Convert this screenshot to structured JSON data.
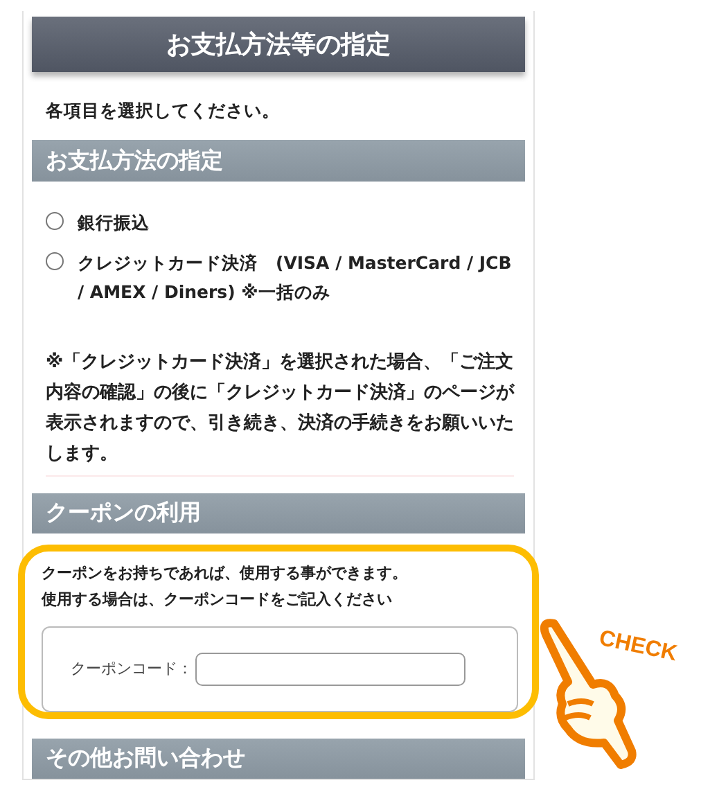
{
  "header": {
    "title": "お支払方法等の指定"
  },
  "intro": "各項目を選択してください。",
  "payment": {
    "title": "お支払方法の指定",
    "options": [
      {
        "label": "銀行振込",
        "selected": false
      },
      {
        "label": "クレジットカード決済　(VISA / MasterCard / JCB / AMEX / Diners) ※一括のみ",
        "selected": false
      }
    ],
    "note": "※「クレジットカード決済」を選択された場合、「ご注文内容の確認」の後に「クレジットカード決済」のページが表示されますので、引き続き、決済の手続きをお願いいたします。"
  },
  "coupon": {
    "title": "クーポンの利用",
    "highlighted": true,
    "lines": [
      "クーポンをお持ちであれば、使用する事ができます。",
      "使用する場合は、クーポンコードをご記入ください"
    ],
    "field_label": "クーポンコード："
  },
  "other": {
    "title": "その他お問い合わせ"
  },
  "check_badge": {
    "label": "CHECK"
  }
}
